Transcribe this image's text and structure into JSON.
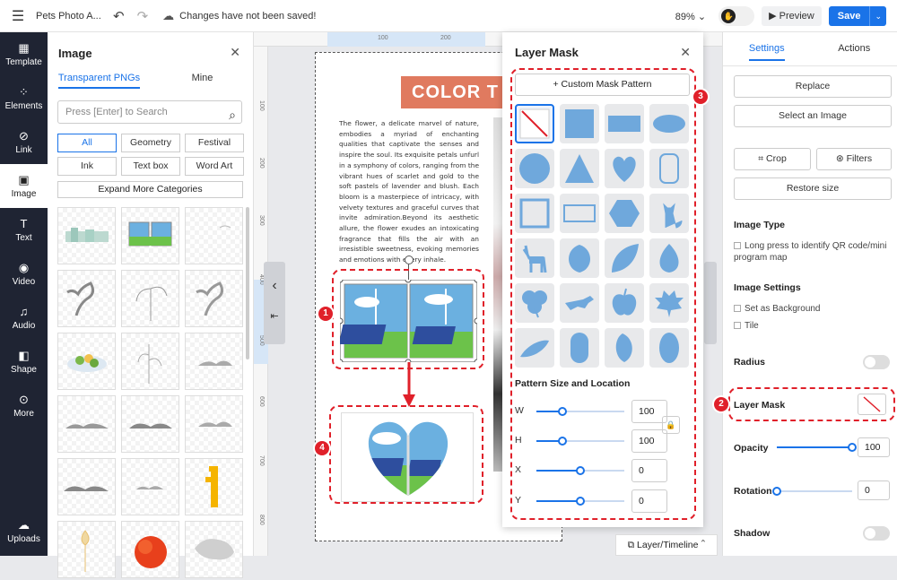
{
  "topbar": {
    "doc_title": "Pets Photo A...",
    "save_status": "Changes have not been saved!",
    "zoom": "89%",
    "preview_label": "Preview",
    "save_label": "Save"
  },
  "nav": {
    "items": [
      {
        "label": "Template",
        "icon": "template-icon"
      },
      {
        "label": "Elements",
        "icon": "elements-icon"
      },
      {
        "label": "Link",
        "icon": "link-icon"
      },
      {
        "label": "Image",
        "icon": "image-icon"
      },
      {
        "label": "Text",
        "icon": "text-icon"
      },
      {
        "label": "Video",
        "icon": "video-icon"
      },
      {
        "label": "Audio",
        "icon": "audio-icon"
      },
      {
        "label": "Shape",
        "icon": "shape-icon"
      },
      {
        "label": "More",
        "icon": "more-icon"
      }
    ],
    "uploads_label": "Uploads"
  },
  "image_panel": {
    "title": "Image",
    "tabs": [
      "Transparent PNGs",
      "Mine"
    ],
    "search_placeholder": "Press [Enter] to Search",
    "categories": [
      "All",
      "Geometry",
      "Festival",
      "Ink",
      "Text box",
      "Word Art"
    ],
    "expand_label": "Expand More Categories"
  },
  "canvas": {
    "ruler_h": [
      "100",
      "200",
      "300"
    ],
    "ruler_v": [
      "100",
      "200",
      "300",
      "400",
      "500",
      "600",
      "700",
      "800"
    ],
    "heading": "COLOR T",
    "paragraph": "The flower, a delicate marvel of nature, embodies a myriad of enchanting qualities that captivate the senses and inspire the soul. Its exquisite petals unfurl in a symphony of colors, ranging from the vibrant hues of scarlet and gold to the soft pastels of lavender and blush. Each bloom is a masterpiece of intricacy, with velvety textures and graceful curves that invite admiration.Beyond its aesthetic allure, the flower exudes an intoxicating fragrance that fills the air with an irresistible sweetness, evoking memories and emotions with every inhale."
  },
  "layer_mask": {
    "title": "Layer Mask",
    "custom_label": "Custom Mask Pattern",
    "section_title": "Pattern Size and Location",
    "sliders": [
      {
        "label": "W",
        "value": "100",
        "level": 0.3
      },
      {
        "label": "H",
        "value": "100",
        "level": 0.3
      },
      {
        "label": "X",
        "value": "0",
        "level": 0.5
      },
      {
        "label": "Y",
        "value": "0",
        "level": 0.5
      }
    ]
  },
  "settings": {
    "tabs": [
      "Settings",
      "Actions"
    ],
    "replace_label": "Replace",
    "select_image_label": "Select an Image",
    "crop_label": "Crop",
    "filters_label": "Filters",
    "restore_label": "Restore size",
    "image_type_title": "Image Type",
    "qr_label": "Long press to identify QR code/mini program map",
    "image_settings_title": "Image Settings",
    "bg_label": "Set as Background",
    "tile_label": "Tile",
    "radius_label": "Radius",
    "layer_mask_label": "Layer Mask",
    "opacity_label": "Opacity",
    "opacity_value": "100",
    "opacity_level": 1.0,
    "rotation_label": "Rotation",
    "rotation_value": "0",
    "rotation_level": 0.0,
    "shadow_label": "Shadow"
  },
  "layer_timeline": "Layer/Timeline",
  "badges": [
    "1",
    "2",
    "3",
    "4"
  ],
  "colors": {
    "accent": "#1a73e8",
    "annotation": "#e0202a",
    "mask_shape": "#6fa8dc",
    "title_bg": "#e07a5f"
  }
}
